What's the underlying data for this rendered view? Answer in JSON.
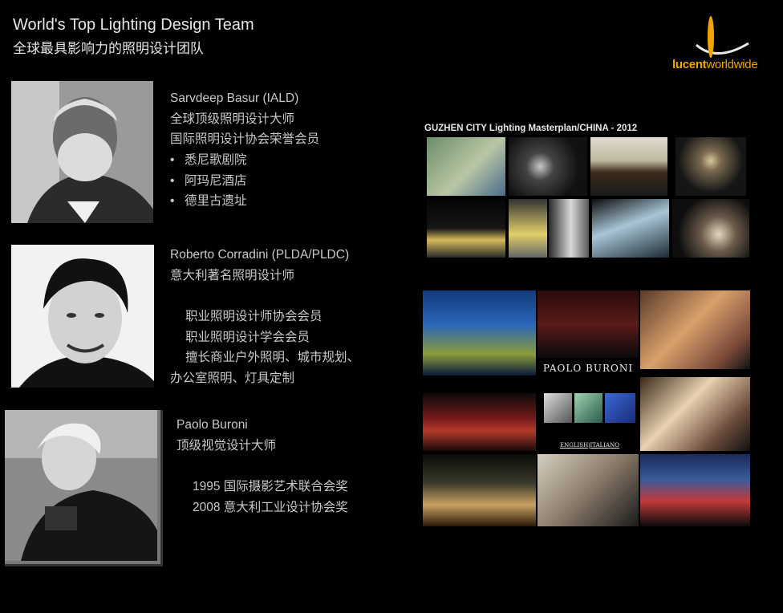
{
  "header": {
    "title_en": "World's Top Lighting Design Team",
    "title_zh": "全球最具影响力的照明设计团队"
  },
  "logo": {
    "text_bold": "lucent",
    "text_regular": "worldwide",
    "color": "#f2a400"
  },
  "designers": [
    {
      "lines": [
        "Sarvdeep Basur (IALD)",
        "全球顶级照明设计大师",
        "国际照明设计协会荣誉会员"
      ],
      "bullets": [
        "悉尼歌剧院",
        "阿玛尼酒店",
        "德里古遗址"
      ]
    },
    {
      "lines": [
        "Roberto Corradini (PLDA/PLDC)",
        "意大利著名照明设计师",
        "",
        "职业照明设计师协会会员",
        "职业照明设计学会会员",
        "擅长商业户外照明、城市规划、",
        "办公室照明、灯具定制"
      ]
    },
    {
      "lines": [
        "Paolo  Buroni",
        "顶级视觉设计大师",
        "",
        "1995 国际摄影艺术联合会奖",
        "2008 意大利工业设计协会奖"
      ]
    }
  ],
  "collage": {
    "title": "GUZHEN CITY Lighting Masterplan/CHINA - 2012",
    "caption_paolo": "PAOLO BURONI",
    "caption_lang": "ENGLISH|ITALIANO"
  }
}
